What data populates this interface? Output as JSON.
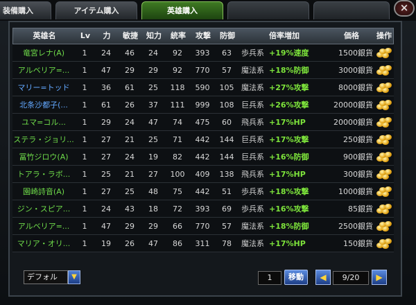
{
  "tabs": [
    {
      "label": "装備購入",
      "active": false
    },
    {
      "label": "アイテム購入",
      "active": false
    },
    {
      "label": "英雄購入",
      "active": true
    },
    {
      "label": "",
      "active": false
    },
    {
      "label": "",
      "active": false
    }
  ],
  "close_glyph": "×",
  "columns": [
    "英雄名",
    "Lv",
    "力",
    "敏捷",
    "知力",
    "統率",
    "攻撃",
    "防御",
    "倍率増加",
    "価格",
    "操作"
  ],
  "rows": [
    {
      "name": "竜宮レナ(A)",
      "lv": "1",
      "str": "24",
      "agi": "46",
      "int": "24",
      "lead": "92",
      "atk": "393",
      "def": "63",
      "bonus_kind": "歩兵系",
      "bonus_val": "+19%速度",
      "price": "1500銀貨",
      "name_color": "green"
    },
    {
      "name": "アルベリア=...",
      "lv": "1",
      "str": "47",
      "agi": "29",
      "int": "29",
      "lead": "92",
      "atk": "770",
      "def": "57",
      "bonus_kind": "魔法系",
      "bonus_val": "+18%防御",
      "price": "3000銀貨",
      "name_color": "green"
    },
    {
      "name": "マリー=トッド",
      "lv": "1",
      "str": "36",
      "agi": "61",
      "int": "25",
      "lead": "118",
      "atk": "590",
      "def": "105",
      "bonus_kind": "魔法系",
      "bonus_val": "+27%攻撃",
      "price": "8000銀貨",
      "name_color": "blue"
    },
    {
      "name": "北条沙都子(...",
      "lv": "1",
      "str": "61",
      "agi": "26",
      "int": "37",
      "lead": "111",
      "atk": "999",
      "def": "108",
      "bonus_kind": "巨兵系",
      "bonus_val": "+26%攻撃",
      "price": "20000銀貨",
      "name_color": "blue"
    },
    {
      "name": "ユマ=コル...",
      "lv": "1",
      "str": "29",
      "agi": "24",
      "int": "47",
      "lead": "74",
      "atk": "475",
      "def": "60",
      "bonus_kind": "飛兵系",
      "bonus_val": "+17%HP",
      "price": "20000銀貨",
      "name_color": "green"
    },
    {
      "name": "ステラ・ジョリ...",
      "lv": "1",
      "str": "27",
      "agi": "21",
      "int": "25",
      "lead": "71",
      "atk": "442",
      "def": "144",
      "bonus_kind": "巨兵系",
      "bonus_val": "+17%攻撃",
      "price": "250銀貨",
      "name_color": "green"
    },
    {
      "name": "冨竹ジロウ(A)",
      "lv": "1",
      "str": "27",
      "agi": "24",
      "int": "19",
      "lead": "82",
      "atk": "442",
      "def": "144",
      "bonus_kind": "巨兵系",
      "bonus_val": "+16%防御",
      "price": "900銀貨",
      "name_color": "green"
    },
    {
      "name": "トアラ・ラボ...",
      "lv": "1",
      "str": "25",
      "agi": "21",
      "int": "27",
      "lead": "100",
      "atk": "409",
      "def": "138",
      "bonus_kind": "飛兵系",
      "bonus_val": "+17%HP",
      "price": "300銀貨",
      "name_color": "green"
    },
    {
      "name": "園崎詩音(A)",
      "lv": "1",
      "str": "27",
      "agi": "25",
      "int": "48",
      "lead": "75",
      "atk": "442",
      "def": "51",
      "bonus_kind": "歩兵系",
      "bonus_val": "+18%攻撃",
      "price": "1000銀貨",
      "name_color": "green"
    },
    {
      "name": "ジン・スピア...",
      "lv": "1",
      "str": "24",
      "agi": "43",
      "int": "18",
      "lead": "72",
      "atk": "393",
      "def": "69",
      "bonus_kind": "歩兵系",
      "bonus_val": "+16%攻撃",
      "price": "85銀貨",
      "name_color": "green"
    },
    {
      "name": "アルベリア=...",
      "lv": "1",
      "str": "47",
      "agi": "29",
      "int": "29",
      "lead": "66",
      "atk": "770",
      "def": "57",
      "bonus_kind": "魔法系",
      "bonus_val": "+18%防御",
      "price": "2500銀貨",
      "name_color": "green"
    },
    {
      "name": "マリア・オリ...",
      "lv": "1",
      "str": "19",
      "agi": "26",
      "int": "47",
      "lead": "86",
      "atk": "311",
      "def": "78",
      "bonus_kind": "魔法系",
      "bonus_val": "+17%HP",
      "price": "150銀貨",
      "name_color": "green"
    }
  ],
  "bottom": {
    "sort_select": "デフォル",
    "sort_arrow": "▼",
    "page_input": "1",
    "go_label": "移動",
    "prev_glyph": "◀",
    "page_label": "9/20",
    "next_glyph": "▶"
  },
  "colors": {
    "name_green": "#6fdc4a",
    "name_blue": "#63a8ff",
    "bonus_green": "#7de33b",
    "active_tab": "#3f7a23"
  }
}
